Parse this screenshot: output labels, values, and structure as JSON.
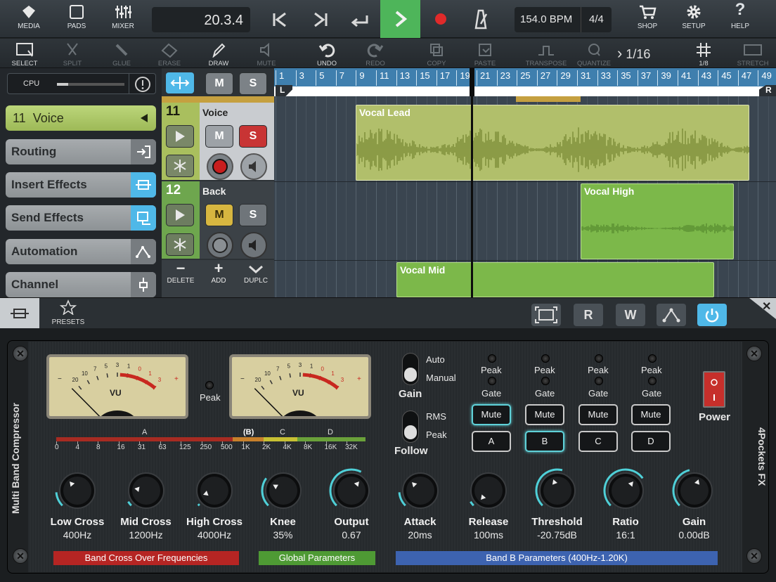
{
  "toolbar": {
    "media": "MEDIA",
    "pads": "PADS",
    "mixer": "MIXER",
    "position": "20.3.4",
    "bpm": "154.0 BPM",
    "signature": "4/4",
    "shop": "SHOP",
    "setup": "SETUP",
    "help": "HELP"
  },
  "tools": {
    "select": "SELECT",
    "split": "SPLIT",
    "glue": "GLUE",
    "erase": "ERASE",
    "draw": "DRAW",
    "mute": "MUTE",
    "undo": "UNDO",
    "redo": "REDO",
    "copy": "COPY",
    "paste": "PASTE",
    "transpose": "TRANSPOSE",
    "quantize": "QUANTIZE",
    "quantize_value": "1/16",
    "grid_value": "1/8",
    "stretch": "STRETCH"
  },
  "left": {
    "cpu": "CPU",
    "track_button": {
      "num": "11",
      "name": "Voice"
    },
    "items": [
      "Routing",
      "Insert Effects",
      "Send Effects",
      "Automation",
      "Channel"
    ]
  },
  "tracks": [
    {
      "num": "11",
      "name": "Voice"
    },
    {
      "num": "12",
      "name": "Back"
    }
  ],
  "track_actions": {
    "delete": "DELETE",
    "add": "ADD",
    "duplicate": "DUPLC"
  },
  "ruler": {
    "bars": [
      "1",
      "3",
      "5",
      "7",
      "9",
      "11",
      "13",
      "15",
      "17",
      "19",
      "21",
      "23",
      "25",
      "27",
      "29",
      "31",
      "33",
      "35",
      "37",
      "39",
      "41",
      "43",
      "45",
      "47",
      "49"
    ],
    "left_marker": "L",
    "right_marker": "R"
  },
  "clips": [
    "Vocal Lead",
    "Vocal High",
    "Vocal Mid"
  ],
  "fxbar": {
    "presets": "PRESETS",
    "read": "R",
    "write": "W"
  },
  "plugin": {
    "name": "Multi Band Compressor",
    "brand": "4Pockets FX",
    "vu_label": "VU",
    "vu_scale": [
      "20",
      "10",
      "7",
      "5",
      "3",
      "1",
      "0",
      "1",
      "3"
    ],
    "peak": "Peak",
    "gain_mode": {
      "auto": "Auto",
      "manual": "Manual",
      "title": "Gain"
    },
    "follow_mode": {
      "rms": "RMS",
      "peak": "Peak",
      "title": "Follow"
    },
    "bands": [
      {
        "label": "A",
        "peak": "Peak",
        "gate": "Gate",
        "mute": "Mute"
      },
      {
        "label": "B",
        "peak": "Peak",
        "gate": "Gate",
        "mute": "Mute"
      },
      {
        "label": "C",
        "peak": "Peak",
        "gate": "Gate",
        "mute": "Mute"
      },
      {
        "label": "D",
        "peak": "Peak",
        "gate": "Gate",
        "mute": "Mute"
      }
    ],
    "power": "Power",
    "freq_bands": {
      "a": "A",
      "b": "(B)",
      "c": "C",
      "d": "D"
    },
    "freq_scale": [
      "0",
      "4",
      "8",
      "16",
      "31",
      "63",
      "125",
      "250",
      "500",
      "1K",
      "2K",
      "4K",
      "8K",
      "16K",
      "32K"
    ],
    "knobs": [
      {
        "label": "Low Cross",
        "value": "400Hz"
      },
      {
        "label": "Mid Cross",
        "value": "1200Hz"
      },
      {
        "label": "High Cross",
        "value": "4000Hz"
      },
      {
        "label": "Knee",
        "value": "35%"
      },
      {
        "label": "Output",
        "value": "0.67"
      },
      {
        "label": "Attack",
        "value": "20ms"
      },
      {
        "label": "Release",
        "value": "100ms"
      },
      {
        "label": "Threshold",
        "value": "-20.75dB"
      },
      {
        "label": "Ratio",
        "value": "16:1"
      },
      {
        "label": "Gain",
        "value": "0.00dB"
      }
    ],
    "sections": {
      "crossover": "Band Cross Over Frequencies",
      "global": "Global Parameters",
      "band": "Band B Parameters (400Hz-1.20K)"
    }
  },
  "colors": {
    "accent": "#4fb8e8",
    "play": "#4eb55a",
    "clip_lead": "#a9b95a",
    "clip_green": "#7cb84a"
  }
}
